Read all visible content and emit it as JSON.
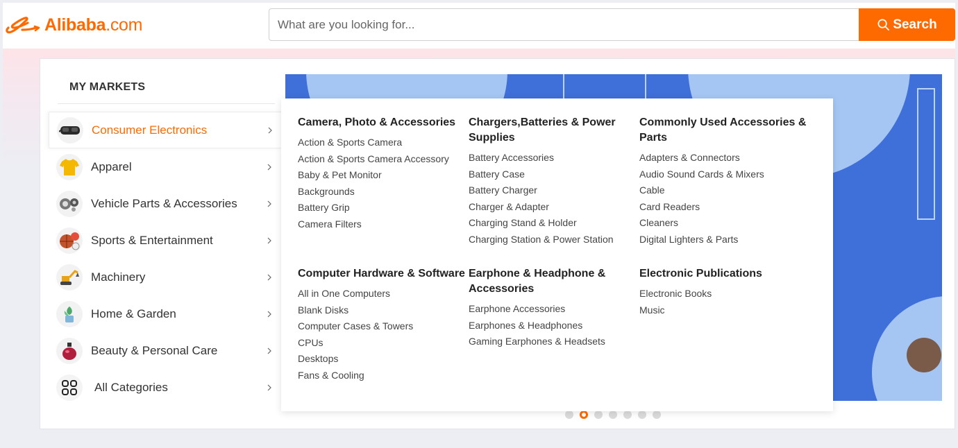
{
  "header": {
    "logo_text": "Alibaba",
    "logo_suffix": ".com",
    "search_placeholder": "What are you looking for...",
    "search_value": "",
    "search_button": "Search",
    "accent_color": "#ff6a00"
  },
  "markets": {
    "title": "MY MARKETS",
    "items": [
      {
        "label": "Consumer Electronics",
        "icon": "vr-headset-icon",
        "active": true
      },
      {
        "label": "Apparel",
        "icon": "tshirt-icon",
        "active": false
      },
      {
        "label": "Vehicle Parts & Accessories",
        "icon": "engine-parts-icon",
        "active": false
      },
      {
        "label": "Sports & Entertainment",
        "icon": "balls-icon",
        "active": false
      },
      {
        "label": "Machinery",
        "icon": "excavator-icon",
        "active": false
      },
      {
        "label": "Home & Garden",
        "icon": "plant-icon",
        "active": false
      },
      {
        "label": "Beauty & Personal Care",
        "icon": "perfume-icon",
        "active": false
      },
      {
        "label": "All Categories",
        "icon": "grid-icon",
        "active": false
      }
    ]
  },
  "dropdown": {
    "groups": [
      {
        "title": "Camera, Photo & Accessories",
        "links": [
          "Action & Sports Camera",
          "Action & Sports Camera Accessory",
          "Baby & Pet Monitor",
          "Backgrounds",
          "Battery Grip",
          "Camera Filters"
        ]
      },
      {
        "title": "Chargers,Batteries & Power Supplies",
        "links": [
          "Battery Accessories",
          "Battery Case",
          "Battery Charger",
          "Charger & Adapter",
          "Charging Stand & Holder",
          "Charging Station & Power Station"
        ]
      },
      {
        "title": "Commonly Used Accessories & Parts",
        "links": [
          "Adapters & Connectors",
          "Audio Sound Cards & Mixers",
          "Cable",
          "Card Readers",
          "Cleaners",
          "Digital Lighters & Parts"
        ]
      },
      {
        "title": "Computer Hardware & Software",
        "links": [
          "All in One Computers",
          "Blank Disks",
          "Computer Cases & Towers",
          "CPUs",
          "Desktops",
          "Fans & Cooling"
        ]
      },
      {
        "title": "Earphone & Headphone & Accessories",
        "links": [
          "Earphone Accessories",
          "Earphones & Headphones",
          "Gaming Earphones & Headsets"
        ]
      },
      {
        "title": "Electronic Publications",
        "links": [
          "Electronic Books",
          "Music"
        ]
      }
    ]
  },
  "banner": {
    "background_color": "#3f6fd8",
    "slide_count": 7,
    "active_slide": 2
  }
}
